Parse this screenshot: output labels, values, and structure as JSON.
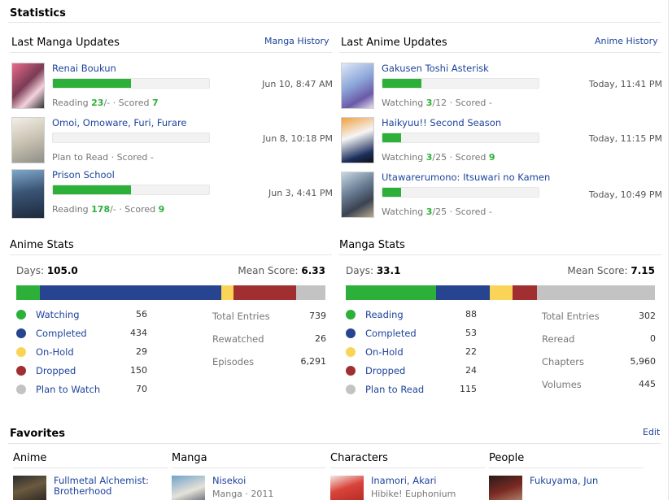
{
  "statistics_title": "Statistics",
  "manga_updates": {
    "heading": "Last Manga Updates",
    "history_link": "Manga History",
    "items": [
      {
        "title": "Renai Boukun",
        "progress": 0.5,
        "date": "Jun 10, 8:47 AM",
        "status_prefix": "Reading",
        "progress_value": "23",
        "progress_total": "/-",
        "score_prefix": "· Scored",
        "score": "7"
      },
      {
        "title": "Omoi, Omoware, Furi, Furare",
        "progress": 0,
        "date": "Jun 8, 10:18 PM",
        "status_prefix": "Plan to Read · Scored -",
        "progress_value": "",
        "progress_total": "",
        "score_prefix": "",
        "score": ""
      },
      {
        "title": "Prison School",
        "progress": 0.5,
        "date": "Jun 3, 4:41 PM",
        "status_prefix": "Reading",
        "progress_value": "178",
        "progress_total": "/-",
        "score_prefix": "· Scored",
        "score": "9"
      }
    ]
  },
  "anime_updates": {
    "heading": "Last Anime Updates",
    "history_link": "Anime History",
    "items": [
      {
        "title": "Gakusen Toshi Asterisk",
        "progress": 0.25,
        "date": "Today, 11:41 PM",
        "status_prefix": "Watching",
        "progress_value": "3",
        "progress_total": "/12",
        "score_prefix": "· Scored",
        "score": "-"
      },
      {
        "title": "Haikyuu!! Second Season",
        "progress": 0.12,
        "date": "Today, 11:15 PM",
        "status_prefix": "Watching",
        "progress_value": "3",
        "progress_total": "/25",
        "score_prefix": "· Scored",
        "score": "9"
      },
      {
        "title": "Utawarerumono: Itsuwari no Kamen",
        "progress": 0.12,
        "date": "Today, 10:49 PM",
        "status_prefix": "Watching",
        "progress_value": "3",
        "progress_total": "/25",
        "score_prefix": "· Scored",
        "score": "-"
      }
    ]
  },
  "anime_stats": {
    "heading": "Anime Stats",
    "days_label": "Days:",
    "days": "105.0",
    "mean_label": "Mean Score:",
    "mean": "6.33",
    "legend": [
      {
        "label": "Watching",
        "value": "56",
        "color": "#2db039"
      },
      {
        "label": "Completed",
        "value": "434",
        "color": "#26448f"
      },
      {
        "label": "On-Hold",
        "value": "29",
        "color": "#f9d457"
      },
      {
        "label": "Dropped",
        "value": "150",
        "color": "#a12f31"
      },
      {
        "label": "Plan to Watch",
        "value": "70",
        "color": "#c3c3c3"
      }
    ],
    "totals": [
      {
        "label": "Total Entries",
        "value": "739"
      },
      {
        "label": "Rewatched",
        "value": "26"
      },
      {
        "label": "Episodes",
        "value": "6,291"
      }
    ]
  },
  "manga_stats": {
    "heading": "Manga Stats",
    "days_label": "Days:",
    "days": "33.1",
    "mean_label": "Mean Score:",
    "mean": "7.15",
    "legend": [
      {
        "label": "Reading",
        "value": "88",
        "color": "#2db039"
      },
      {
        "label": "Completed",
        "value": "53",
        "color": "#26448f"
      },
      {
        "label": "On-Hold",
        "value": "22",
        "color": "#f9d457"
      },
      {
        "label": "Dropped",
        "value": "24",
        "color": "#a12f31"
      },
      {
        "label": "Plan to Read",
        "value": "115",
        "color": "#c3c3c3"
      }
    ],
    "totals": [
      {
        "label": "Total Entries",
        "value": "302"
      },
      {
        "label": "Reread",
        "value": "0"
      },
      {
        "label": "Chapters",
        "value": "5,960"
      },
      {
        "label": "Volumes",
        "value": "445"
      }
    ]
  },
  "favorites": {
    "heading": "Favorites",
    "edit_link": "Edit",
    "columns": [
      {
        "heading": "Anime",
        "name": "Fullmetal Alchemist: Brotherhood",
        "sub": ""
      },
      {
        "heading": "Manga",
        "name": "Nisekoi",
        "sub": "Manga · 2011"
      },
      {
        "heading": "Characters",
        "name": "Inamori, Akari",
        "sub": "Hibike! Euphonium"
      },
      {
        "heading": "People",
        "name": "Fukuyama, Jun",
        "sub": ""
      }
    ]
  }
}
